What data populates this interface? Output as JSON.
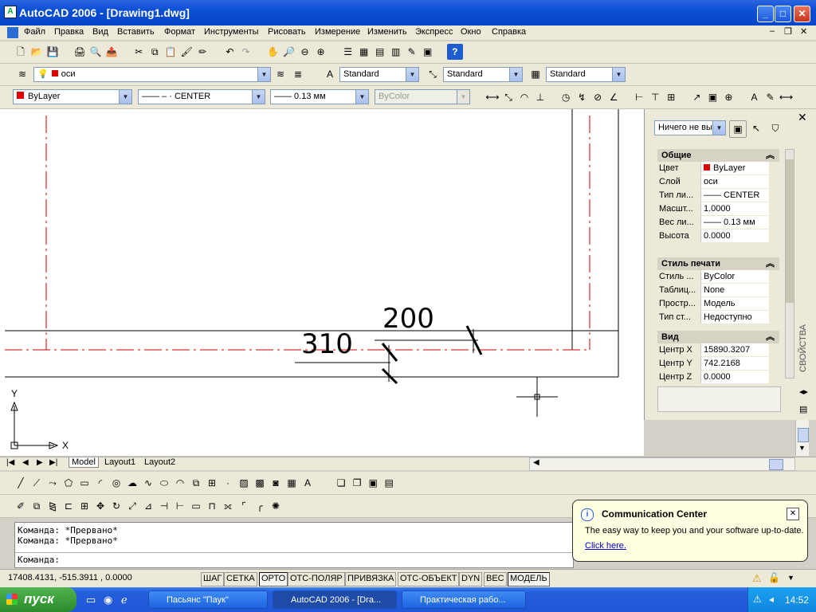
{
  "window": {
    "title": "AutoCAD 2006 - [Drawing1.dwg]",
    "app_icon_label": "A"
  },
  "menu": [
    "Файл",
    "Правка",
    "Вид",
    "Вставить",
    "Формат",
    "Инструменты",
    "Рисовать",
    "Измерение",
    "Изменить",
    "Экспресс",
    "Окно",
    "Справка"
  ],
  "layers": {
    "current_layer": "оси"
  },
  "styles": {
    "text_style": "Standard",
    "dim_style": "Standard",
    "table_style": "Standard"
  },
  "properties_toolbar": {
    "color": "ByLayer",
    "linetype": "—— – · CENTER",
    "lineweight": "—— 0.13 мм",
    "plotstyle": "ByColor"
  },
  "drawing": {
    "dim_top": "200",
    "dim_bottom": "310",
    "ucs_x": "X",
    "ucs_y": "Y"
  },
  "layout_tabs": [
    "Model",
    "Layout1",
    "Layout2"
  ],
  "properties_palette": {
    "selection": "Ничего не вы",
    "side_title": "СВОЙСТВА",
    "sections": [
      {
        "title": "Общие",
        "rows": [
          {
            "k": "Цвет",
            "v": "ByLayer"
          },
          {
            "k": "Слой",
            "v": "оси"
          },
          {
            "k": "Тип ли...",
            "v": "—— CENTER"
          },
          {
            "k": "Масшт...",
            "v": "1.0000"
          },
          {
            "k": "Вес ли...",
            "v": "—— 0.13 мм"
          },
          {
            "k": "Высота",
            "v": "0.0000"
          }
        ]
      },
      {
        "title": "Стиль печати",
        "rows": [
          {
            "k": "Стиль ...",
            "v": "ByColor"
          },
          {
            "k": "Таблиц...",
            "v": "None"
          },
          {
            "k": "Простр...",
            "v": "Модель"
          },
          {
            "k": "Тип ст...",
            "v": "Недоступно"
          }
        ]
      },
      {
        "title": "Вид",
        "rows": [
          {
            "k": "Центр X",
            "v": "15890.3207"
          },
          {
            "k": "Центр Y",
            "v": "742.2168"
          },
          {
            "k": "Центр Z",
            "v": "0.0000"
          }
        ]
      }
    ]
  },
  "command_line": {
    "lines": [
      "Команда: *Прервано*",
      "Команда: *Прервано*"
    ],
    "prompt": "Команда:"
  },
  "status": {
    "coords": "17408.4131, -515.3911 , 0.0000",
    "toggles": [
      {
        "label": "ШАГ",
        "on": false
      },
      {
        "label": "СЕТКА",
        "on": false
      },
      {
        "label": "ОРТО",
        "on": true
      },
      {
        "label": "ОТС-ПОЛЯР",
        "on": false
      },
      {
        "label": "ПРИВЯЗКА",
        "on": false
      },
      {
        "label": "ОТС-ОБЪЕКТ",
        "on": false
      },
      {
        "label": "DYN",
        "on": false
      },
      {
        "label": "ВЕС",
        "on": false
      },
      {
        "label": "МОДЕЛЬ",
        "on": true
      }
    ]
  },
  "balloon": {
    "title": "Communication Center",
    "text": "The easy way to keep you and your software up-to-date.",
    "link": "Click here."
  },
  "taskbar": {
    "start_label": "пуск",
    "tasks": [
      "Пасьянс \"Паук\"",
      "AutoCAD 2006 - [Dra...",
      "Практическая рабо..."
    ],
    "clock": "14:52"
  },
  "colors": {
    "accent": "#0a4fd4",
    "bylayer_red": "#e00000",
    "center_line": "#d00000"
  }
}
